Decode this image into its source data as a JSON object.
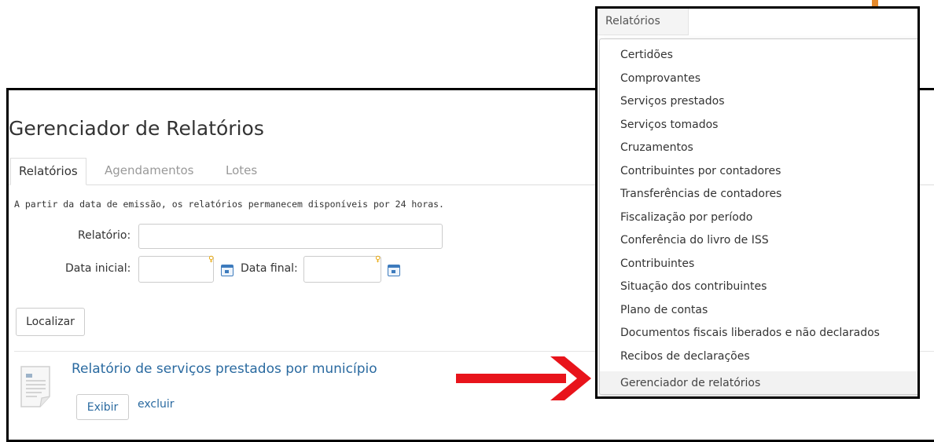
{
  "page": {
    "title": "Gerenciador de Relatórios",
    "tabs": [
      {
        "label": "Relatórios",
        "active": true
      },
      {
        "label": "Agendamentos",
        "active": false
      },
      {
        "label": "Lotes",
        "active": false
      }
    ],
    "info_text": "A partir da data de emissão, os relatórios permanecem disponíveis por 24 horas."
  },
  "form": {
    "report_label": "Relatório:",
    "report_value": "",
    "start_date_label": "Data inicial:",
    "start_date_value": "",
    "end_date_label": "Data final:",
    "end_date_value": "",
    "search_button": "Localizar"
  },
  "results": [
    {
      "title": "Relatório de serviços prestados por município",
      "view_button": "Exibir",
      "delete_link": "excluir"
    }
  ],
  "menu": {
    "header": "Relatórios",
    "items": [
      {
        "label": "Certidões",
        "submenu": true
      },
      {
        "label": "Comprovantes",
        "submenu": true
      },
      {
        "label": "Serviços prestados",
        "submenu": true
      },
      {
        "label": "Serviços tomados",
        "submenu": true
      },
      {
        "label": "Cruzamentos",
        "submenu": true
      },
      {
        "label": "Contribuintes por contadores",
        "submenu": false
      },
      {
        "label": "Transferências de contadores",
        "submenu": false
      },
      {
        "label": "Fiscalização por período",
        "submenu": false
      },
      {
        "label": "Conferência do livro de ISS",
        "submenu": false
      },
      {
        "label": "Contribuintes",
        "submenu": false
      },
      {
        "label": "Situação dos contribuintes",
        "submenu": false
      },
      {
        "label": "Plano de contas",
        "submenu": false
      },
      {
        "label": "Documentos fiscais liberados e não declarados",
        "submenu": false
      },
      {
        "label": "Recibos de declarações",
        "submenu": false
      },
      {
        "label": "Gerenciador de relatórios",
        "submenu": false,
        "highlighted": true
      }
    ]
  },
  "colors": {
    "link": "#2a6aa0",
    "annotation_arrow": "#e8141b",
    "accent_bar": "#e58a2c"
  }
}
